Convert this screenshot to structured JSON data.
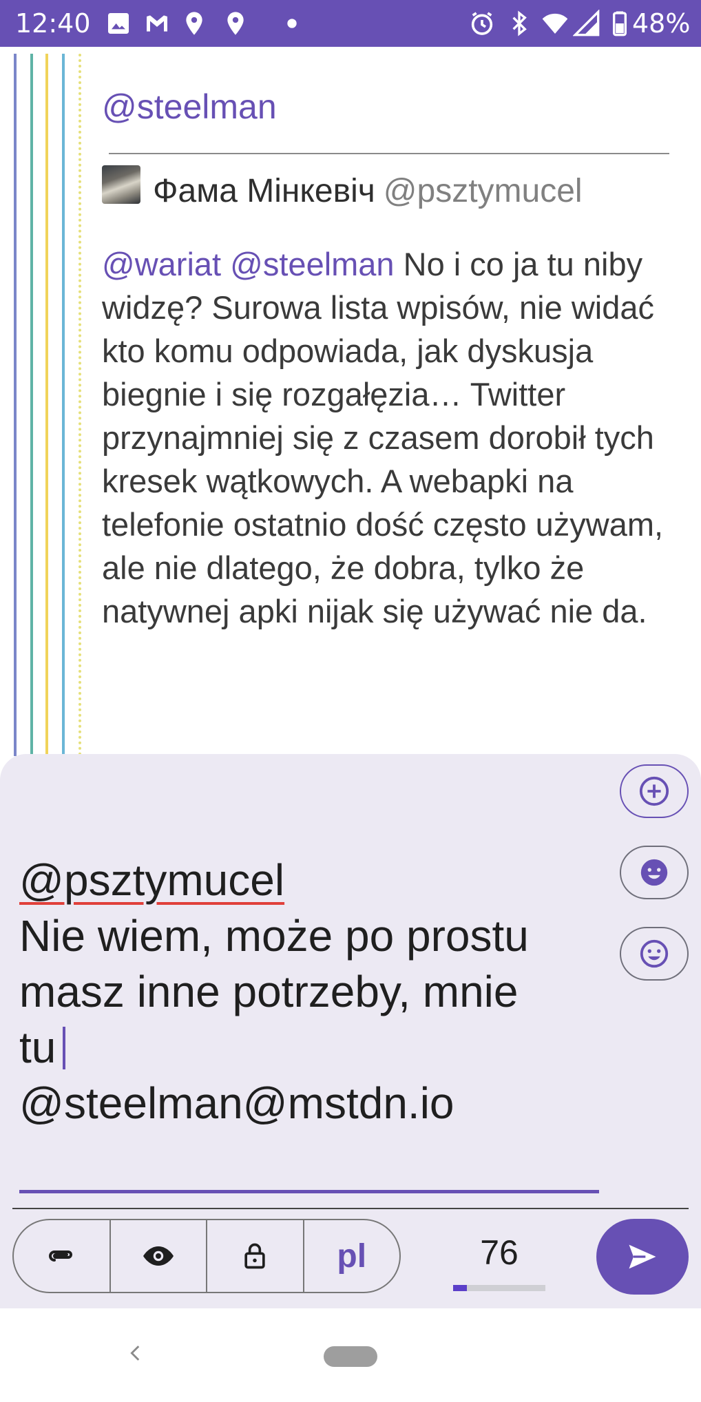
{
  "status_bar": {
    "time": "12:40",
    "battery": "48%",
    "icons": [
      "image-icon",
      "gmail-icon",
      "location-icon",
      "location-icon",
      "dot-icon",
      "alarm-icon",
      "bluetooth-icon",
      "wifi-icon",
      "signal-icon",
      "battery-icon"
    ]
  },
  "thread": {
    "line_colors": [
      "#7b86c9",
      "#5fb3a6",
      "#f0d35a",
      "#6bb6d6"
    ],
    "dotted_color": "#e6e07a"
  },
  "post": {
    "top_mention": "@steelman",
    "author_name": "Фама Мінкевіч",
    "author_handle": "@pszt​ymucel",
    "mention_1": "@wariat",
    "mention_2": "@steelman",
    "body": "No i co ja tu niby widzę? Surowa lista wpisów, nie widać kto komu odpowiada, jak dyskusja biegnie i się rozgałęzia… Twitter przynajmniej się z czasem dorobił tych kresek wątkowych. A webapki na telefonie ostatnio dość często używam, ale nie dlatego, że dobra, tylko że natywnej apki nijak się używać nie da."
  },
  "compose": {
    "mention": "@pszt​ymucel",
    "line_1": "Nie wiem, może po prostu",
    "line_2": "masz inne potrzeby, mnie",
    "line_3": "tu",
    "line_4": "@steelman@mstdn.io",
    "language": "pl",
    "char_counter": "76",
    "char_counter_fraction": 0.15,
    "side_buttons": [
      "add-circle-icon",
      "emoji-filled-icon",
      "emoji-outline-icon"
    ],
    "toolbar_icons": [
      "attach-icon",
      "eye-icon",
      "lock-icon"
    ],
    "accent_color": "#6750b4"
  },
  "nav": {
    "back_icon": "chevron-left-icon",
    "home_icon": "home-pill-icon"
  }
}
